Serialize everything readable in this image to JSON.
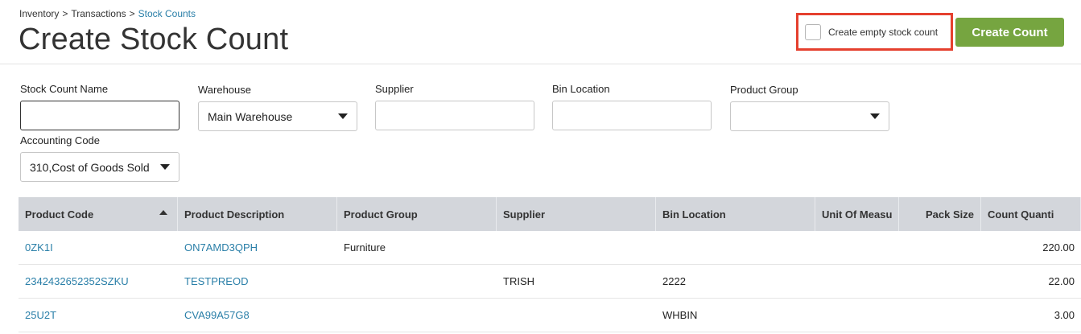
{
  "breadcrumb": {
    "items": [
      "Inventory",
      "Transactions",
      "Stock Counts"
    ],
    "separator": ">"
  },
  "page_title": "Create Stock Count",
  "empty_count": {
    "label": "Create empty stock count",
    "checked": false
  },
  "create_button": {
    "label": "Create Count",
    "color": "#76a540"
  },
  "highlight_color": "#e5402e",
  "form": {
    "stock_count_name": {
      "label": "Stock Count Name",
      "value": ""
    },
    "warehouse": {
      "label": "Warehouse",
      "value": "Main Warehouse"
    },
    "supplier": {
      "label": "Supplier",
      "value": ""
    },
    "bin_location": {
      "label": "Bin Location",
      "value": ""
    },
    "product_group": {
      "label": "Product Group",
      "value": ""
    },
    "accounting_code": {
      "label": "Accounting Code",
      "value": "310,Cost of Goods Sold"
    }
  },
  "table": {
    "columns": [
      "Product Code",
      "Product Description",
      "Product Group",
      "Supplier",
      "Bin Location",
      "Unit Of Measu",
      "Pack Size",
      "Count Quanti"
    ],
    "sorted_column": "Product Code",
    "rows": [
      {
        "product_code": "0ZK1I",
        "product_description": "ON7AMD3QPH",
        "product_group": "Furniture",
        "supplier": "",
        "bin_location": "",
        "unit_of_measure": "",
        "pack_size": "",
        "count_quantity": "220.00"
      },
      {
        "product_code": "2342432652352SZKU",
        "product_description": "TESTPREOD",
        "product_group": "",
        "supplier": "TRISH",
        "bin_location": "2222",
        "unit_of_measure": "",
        "pack_size": "",
        "count_quantity": "22.00"
      },
      {
        "product_code": "25U2T",
        "product_description": "CVA99A57G8",
        "product_group": "",
        "supplier": "",
        "bin_location": "WHBIN",
        "unit_of_measure": "",
        "pack_size": "",
        "count_quantity": "3.00"
      }
    ]
  }
}
